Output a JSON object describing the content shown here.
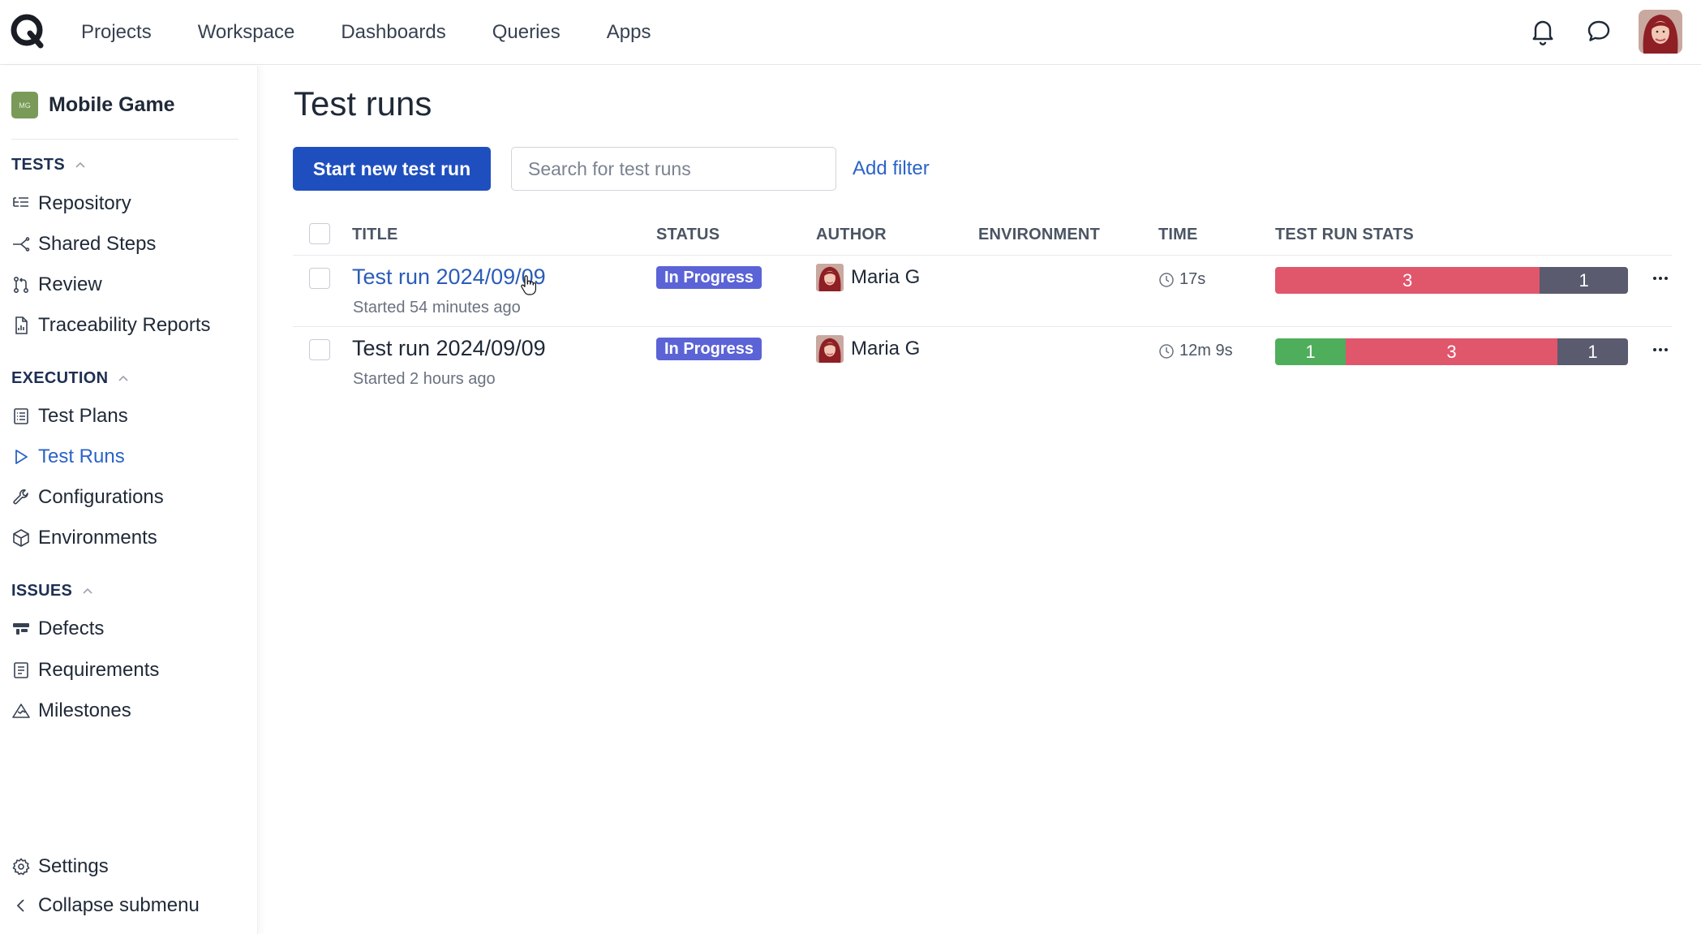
{
  "nav": {
    "items": [
      "Projects",
      "Workspace",
      "Dashboards",
      "Queries",
      "Apps"
    ]
  },
  "sidebar": {
    "project": {
      "badge": "MG",
      "name": "Mobile Game"
    },
    "sections": {
      "tests": {
        "label": "TESTS",
        "items": [
          "Repository",
          "Shared Steps",
          "Review",
          "Traceability Reports"
        ]
      },
      "execution": {
        "label": "EXECUTION",
        "items": [
          "Test Plans",
          "Test Runs",
          "Configurations",
          "Environments"
        ]
      },
      "issues": {
        "label": "ISSUES",
        "items": [
          "Defects",
          "Requirements",
          "Milestones"
        ]
      }
    },
    "footer": {
      "settings": "Settings",
      "collapse": "Collapse submenu"
    }
  },
  "main": {
    "title": "Test runs",
    "start_button": "Start new test run",
    "search_placeholder": "Search for test runs",
    "add_filter": "Add filter",
    "columns": {
      "title": "TITLE",
      "status": "STATUS",
      "author": "AUTHOR",
      "environment": "ENVIRONMENT",
      "time": "TIME",
      "stats": "TEST RUN STATS"
    },
    "rows": [
      {
        "title": "Test run 2024/09/09",
        "started": "Started 54 minutes ago",
        "status": "In Progress",
        "author": "Maria G",
        "environment": "",
        "time": "17s",
        "stats": [
          {
            "label": "3",
            "value": 3,
            "color": "#e0566b"
          },
          {
            "label": "1",
            "value": 1,
            "color": "#5a5b6e"
          }
        ]
      },
      {
        "title": "Test run 2024/09/09",
        "started": "Started 2 hours ago",
        "status": "In Progress",
        "author": "Maria G",
        "environment": "",
        "time": "12m 9s",
        "stats": [
          {
            "label": "1",
            "value": 1,
            "color": "#4fae5c"
          },
          {
            "label": "3",
            "value": 3,
            "color": "#e0566b"
          },
          {
            "label": "1",
            "value": 1,
            "color": "#5a5b6e"
          }
        ]
      }
    ]
  },
  "colors": {
    "primary": "#1f4fbf",
    "link": "#2b63c7",
    "badge": "#5b63d6",
    "passed": "#4fae5c",
    "failed": "#e0566b",
    "skipped": "#5a5b6e"
  }
}
